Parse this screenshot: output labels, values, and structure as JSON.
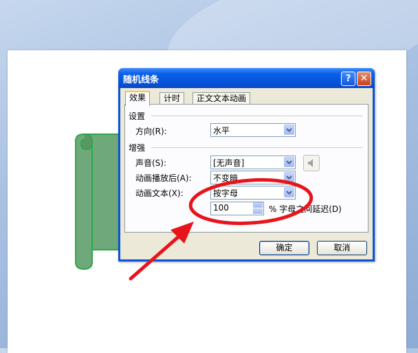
{
  "dialog": {
    "title": "随机线条",
    "help_btn": "?",
    "close_btn": "✕",
    "tabs": [
      {
        "label": "效果",
        "active": true
      },
      {
        "label": "计时",
        "active": false
      },
      {
        "label": "正文文本动画",
        "active": false
      }
    ],
    "settings": {
      "group_label": "设置",
      "direction_label": "方向(R):",
      "direction_value": "水平"
    },
    "enhancements": {
      "group_label": "增强",
      "sound_label": "声音(S):",
      "sound_value": "[无声音]",
      "after_label": "动画播放后(A):",
      "after_value": "不变暗",
      "text_label": "动画文本(X):",
      "text_value": "按字母",
      "delay_value": "100",
      "delay_suffix": "% 字母之间延迟(D)"
    },
    "ok_label": "确定",
    "cancel_label": "取消"
  },
  "colors": {
    "titlebar": "#0a5ee6",
    "highlight_annotation": "#e8141c",
    "scroll_shape_fill": "#6fa87a",
    "scroll_shape_stroke": "#2ea84a"
  },
  "icons": {
    "speaker": "speaker-icon",
    "arrow": "chevron-down-icon"
  }
}
